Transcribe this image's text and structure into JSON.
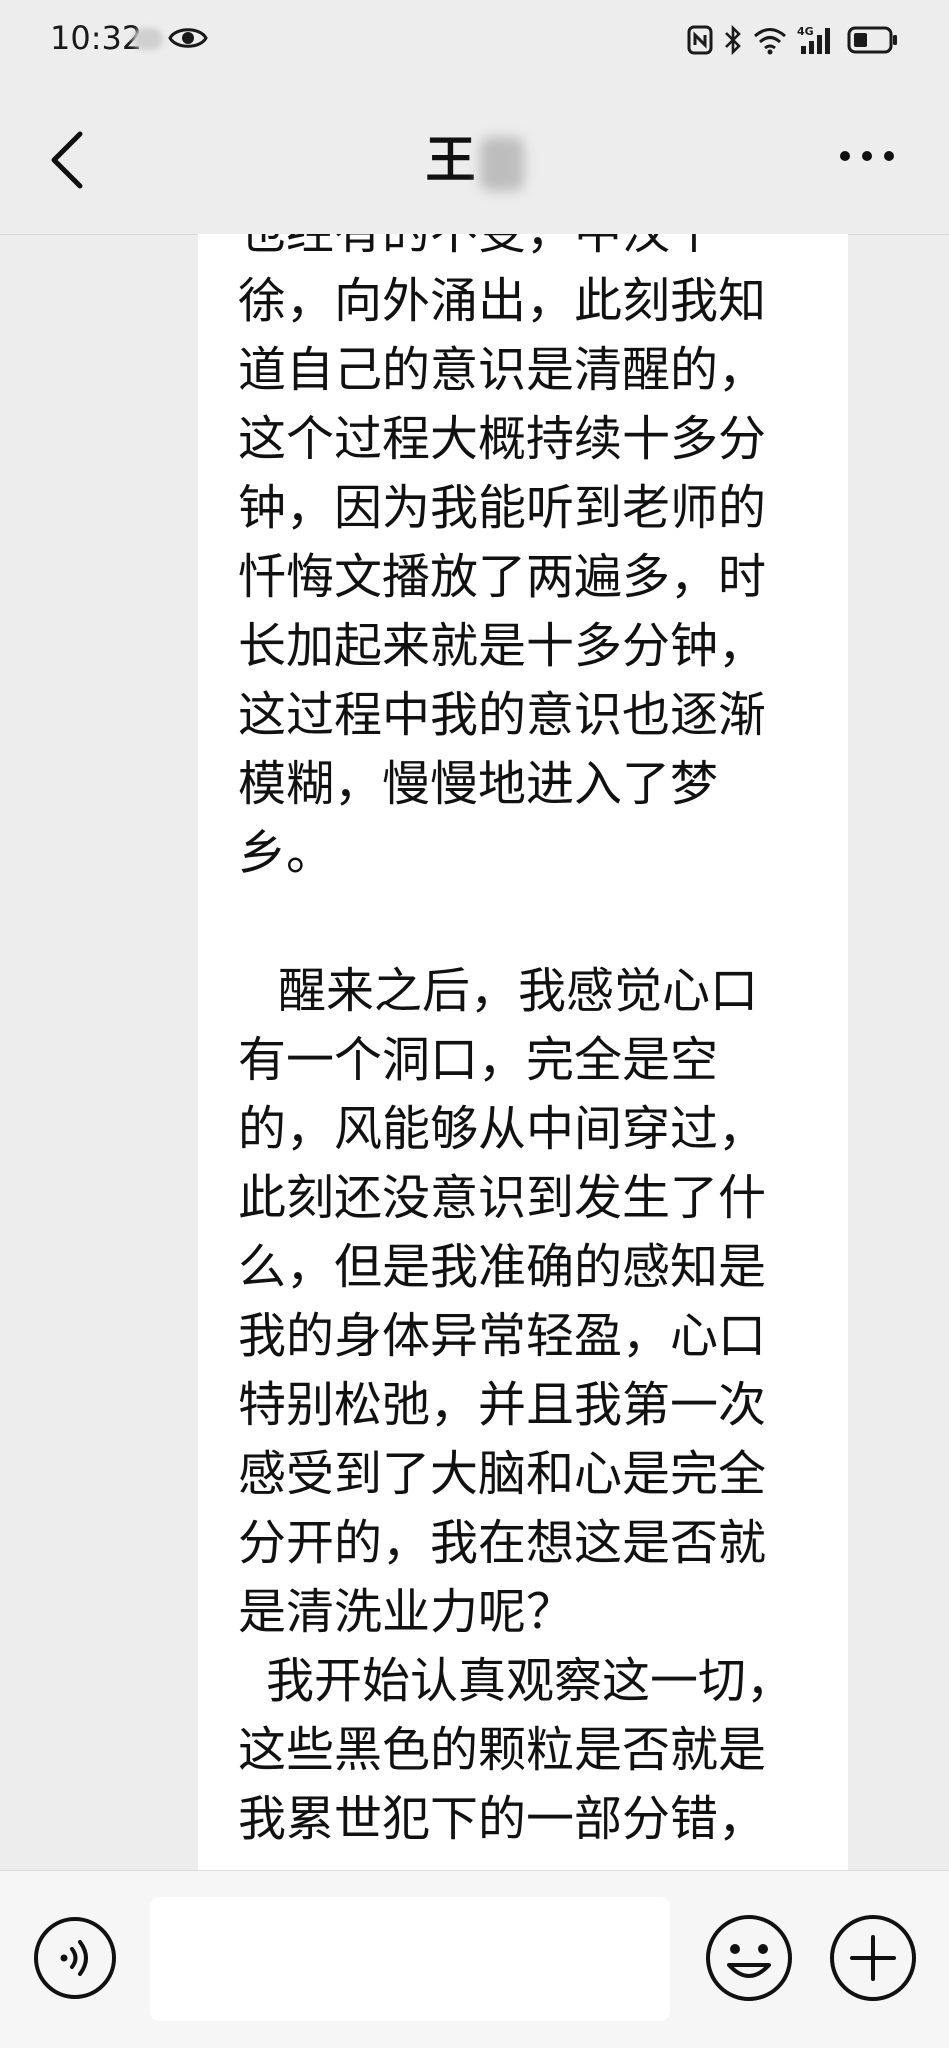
{
  "status_bar": {
    "time": "10:32",
    "network_label": "4G"
  },
  "header": {
    "contact_name": "王"
  },
  "message": {
    "lines": [
      "徐，向外涌出，此刻我知",
      "道自己的意识是清醒的，",
      "这个过程大概持续十多分",
      "钟，因为我能听到老师的",
      "忏悔文播放了两遍多，时",
      "长加起来就是十多分钟，",
      "这过程中我的意识也逐渐",
      "模糊，慢慢地进入了梦",
      "乡。",
      "",
      "醒来之后，我感觉心口",
      "有一个洞口，完全是空",
      "的，风能够从中间穿过，",
      "此刻还没意识到发生了什",
      "么，但是我准确的感知是",
      "我的身体异常轻盈，心口",
      "特别松弛，并且我第一次",
      "感受到了大脑和心是完全",
      "分开的，我在想这是否就",
      "是清洗业力呢？",
      "我开始认真观察这一切，",
      "这些黑色的颗粒是否就是",
      "我累世犯下的一部分错，"
    ]
  },
  "input": {
    "value": "",
    "placeholder": ""
  },
  "colors": {
    "background": "#ededed",
    "bubble": "#ffffff",
    "input_bar": "#f6f6f6",
    "text": "#111111"
  },
  "icons": {
    "back": "chevron-left-icon",
    "more": "more-dots-icon",
    "voice": "voice-icon",
    "emoji": "emoji-icon",
    "add": "plus-circle-icon",
    "eye": "eye-icon",
    "wifi": "wifi-icon",
    "bluetooth": "bluetooth-icon",
    "battery": "battery-icon",
    "nfc": "nfc-icon",
    "signal": "signal-icon"
  }
}
